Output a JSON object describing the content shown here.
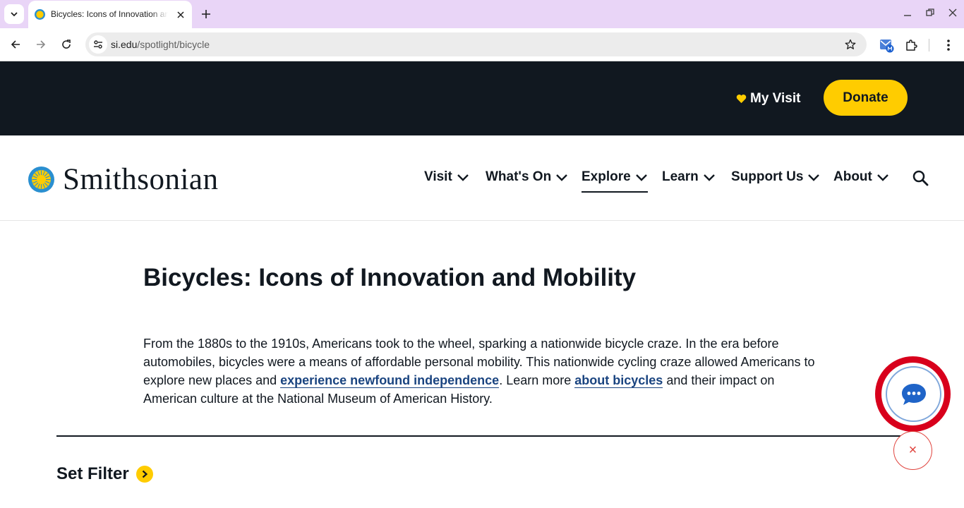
{
  "browser": {
    "tab_title": "Bicycles: Icons of Innovation and Mobility",
    "url_host": "si.edu",
    "url_path": "/spotlight/bicycle"
  },
  "utility_bar": {
    "my_visit_label": "My Visit",
    "donate_label": "Donate"
  },
  "site": {
    "logo_text": "Smithsonian"
  },
  "nav": {
    "items": [
      {
        "label": "Visit"
      },
      {
        "label": "What's On"
      },
      {
        "label": "Explore"
      },
      {
        "label": "Learn"
      },
      {
        "label": "Support Us"
      },
      {
        "label": "About"
      }
    ],
    "active": "Explore"
  },
  "content": {
    "title": "Bicycles: Icons of Innovation and Mobility",
    "intro_part1": "From the 1880s to the 1910s, Americans took to the wheel, sparking a nationwide bicycle craze. In the era before automobiles, bicycles were a means of affordable personal mobility. This nationwide cycling craze allowed Americans to explore new places and ",
    "intro_link1": "experience newfound independence",
    "intro_part2": ". Learn more ",
    "intro_link2": "about bicycles",
    "intro_part3": " and their impact on American culture at the National Museum of American History.",
    "set_filter_label": "Set Filter"
  },
  "widgets": {
    "close_glyph": "×"
  },
  "colors": {
    "dark": "#111820",
    "accent_yellow": "#ffcc00",
    "link_blue": "#1a4480",
    "chat_highlight_red": "#d8001c",
    "chrome_tab_bar": "#e9d5f7"
  }
}
